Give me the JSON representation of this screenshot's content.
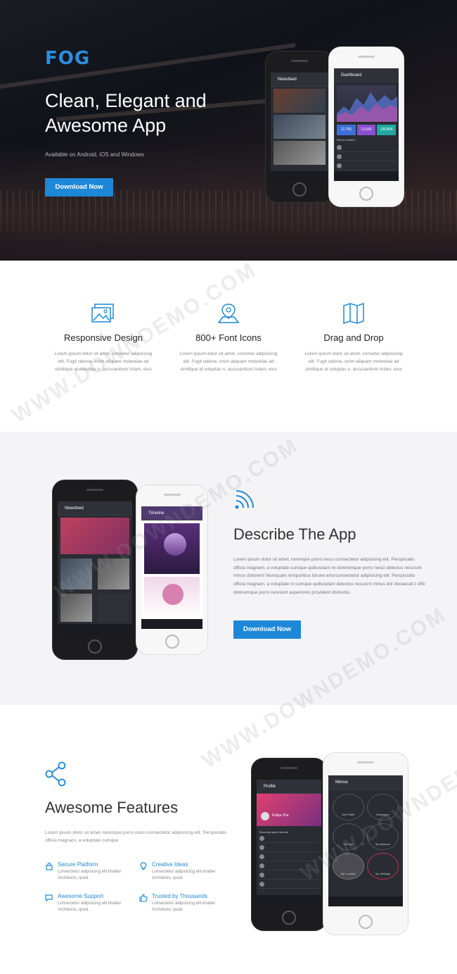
{
  "hero": {
    "logo": "FOG",
    "title": "Clean, Elegant and Awesome App",
    "subtitle": "Available on Android, iOS and Windows",
    "cta": "Download Now",
    "phones": {
      "left_bar": "Newsfeed",
      "right_bar": "Dashboard",
      "stats": [
        "12,765",
        "13,642",
        "135,806"
      ],
      "list_header": "Recent visitors"
    }
  },
  "features": {
    "items": [
      {
        "title": "Responsive Design",
        "text": "Lorem ipsum dolor sit amet, consetur adipisicing elit. Fugit ratione, enim aliquam molestiae ad similique at voluptas n, accusantium totam, eius"
      },
      {
        "title": "800+ Font Icons",
        "text": "Lorem ipsum dolor sit amet, consetur adipisicing elit. Fugit ratione, enim aliquam molestiae ad similique at voluptas n, accusantium totam, eius"
      },
      {
        "title": "Drag and Drop",
        "text": "Lorem ipsum dolor sit amet, consetur adipisicing elit. Fugit ratione, enim aliquam molestiae ad similique at voluptas n, accusantium totam, eius"
      }
    ],
    "icons": [
      "image-icon",
      "map-pin-icon",
      "map-icon"
    ]
  },
  "describe": {
    "title": "Describe The App",
    "text": "Lorem ipsum dolor sit amet, loremque porro nesci consectetur adipisicing elit. Perspiciatis officia magnam, a voluptate cumque quibusdam re doloremque porro nesci delectus nesciunt minus dolorem! Numquam temporibus biruee errorconsectetur adipisicing elit. Perspiciatis officia magnam, a voluptate lo cumque quibusdam delectus nesciunt minus dol obcaecati t offic doloremque porro nesciunt asperiores provident distinctio.",
    "cta": "Download Now",
    "phones": {
      "left_bar": "Newsfeed",
      "right_bar": "Timeline"
    }
  },
  "awesome": {
    "title": "Awesome Features",
    "intro": "Lorem ipsum dolor sit amet, loremque porro nesci consectetur adipisicing elit. Perspiciatis officia magnam, a voluptate cumque",
    "items": [
      {
        "title": "Secure Platform",
        "text": "Lonsectetur adipisicing elit khaber Architecto, quod."
      },
      {
        "title": "Creative Ideas",
        "text": "Lonsectetur adipisicing elit khaber Architecto, quod."
      },
      {
        "title": "Awesome Support",
        "text": "Lonsectetur adipisicing elit khaber Architecto, quod."
      },
      {
        "title": "Trusted by Thousands",
        "text": "Lonsectetur adipisicing elit khaber Architecto, quod."
      }
    ],
    "phones": {
      "left_bar": "Profile",
      "profile_name": "Felipe Zhe",
      "list_header": "Recently added friends",
      "right_bar": "Menus",
      "menu_items": [
        "My Profile",
        "Messages",
        "My Cart",
        "My Balance",
        "My Location",
        "My Settings"
      ]
    }
  },
  "watermark": "WWW.DOWNDEMO.COM",
  "colors": {
    "accent": "#1e88d8",
    "hero_bg": "#14161d",
    "describe_bg": "#f4f4f6"
  }
}
